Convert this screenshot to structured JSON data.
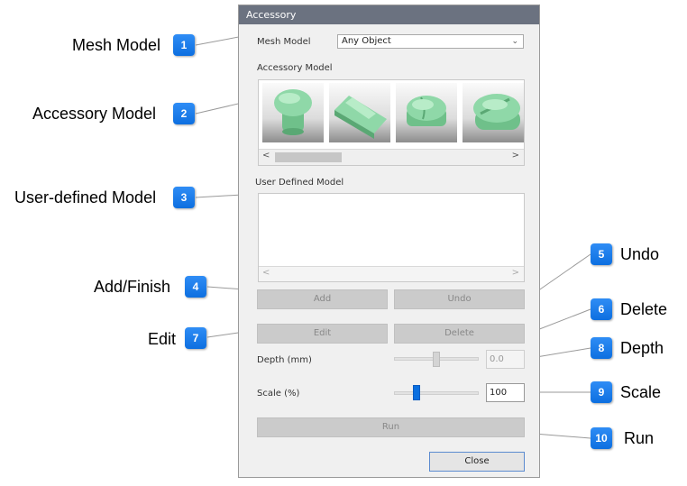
{
  "dialog": {
    "title": "Accessory",
    "mesh_model_label": "Mesh Model",
    "mesh_model_value": "Any Object",
    "accessory_model_label": "Accessory Model",
    "user_defined_label": "User Defined Model",
    "add_label": "Add",
    "undo_label": "Undo",
    "edit_label": "Edit",
    "delete_label": "Delete",
    "depth_label": "Depth (mm)",
    "depth_value": "0.0",
    "depth_slider_level": 0.5,
    "scale_label": "Scale (%)",
    "scale_value": "100",
    "scale_slider_level": 0.27,
    "run_label": "Run",
    "close_label": "Close",
    "scroll_left": "<",
    "scroll_right": ">",
    "dropdown_chevron": "⌄"
  },
  "callouts": [
    {
      "number": "1",
      "label": "Mesh Model"
    },
    {
      "number": "2",
      "label": "Accessory Model"
    },
    {
      "number": "3",
      "label": "User-defined Model"
    },
    {
      "number": "4",
      "label": "Add/Finish"
    },
    {
      "number": "5",
      "label": "Undo"
    },
    {
      "number": "6",
      "label": "Delete"
    },
    {
      "number": "7",
      "label": "Edit"
    },
    {
      "number": "8",
      "label": "Depth"
    },
    {
      "number": "9",
      "label": "Scale"
    },
    {
      "number": "10",
      "label": "Run"
    }
  ],
  "colors": {
    "titlebar": "#6b7280",
    "badge": "#1a7ff0",
    "model_green": "#8fd8a8",
    "slider_accent": "#0a6fe0"
  },
  "icons": [
    "chevron-down-icon",
    "scroll-left-icon",
    "scroll-right-icon"
  ]
}
